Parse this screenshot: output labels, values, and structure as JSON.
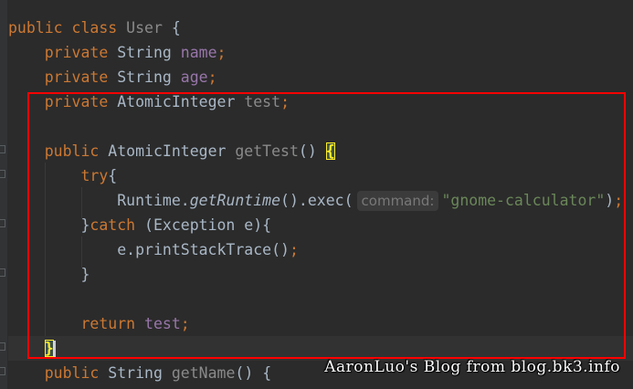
{
  "editor": {
    "lines": {
      "l1": {
        "public": "public",
        "class": "class",
        "name": "User",
        "open": "{"
      },
      "l2": {
        "private": "private",
        "type": "String",
        "field": "name",
        "semi": ";"
      },
      "l3": {
        "private": "private",
        "type": "String",
        "field": "age",
        "semi": ";"
      },
      "l4": {
        "private": "private",
        "type": "AtomicInteger",
        "field": "test",
        "semi": ";"
      },
      "l6": {
        "public": "public",
        "type": "AtomicInteger",
        "method": "getTest",
        "parens": "()",
        "brace": "{"
      },
      "l7": {
        "try": "try",
        "brace": "{"
      },
      "l8": {
        "receiver": "Runtime.",
        "method": "getRuntime",
        "call": "().exec(",
        "hint": "command:",
        "string": "\"gnome-calculator\"",
        "close": ")",
        "semi": ";"
      },
      "l9": {
        "close": "}",
        "catch": "catch",
        "params": " (Exception e){"
      },
      "l10": {
        "call": "e.printStackTrace()",
        "semi": ";"
      },
      "l11": {
        "close": "}"
      },
      "l13": {
        "return": "return",
        "field": "test",
        "semi": ";"
      },
      "l14": {
        "brace": "}"
      },
      "l15": {
        "public": "public",
        "type": "String",
        "method": "getName",
        "parens": "()",
        "brace": "{"
      }
    }
  },
  "watermark": "AaronLuo's Blog from blog.bk3.info",
  "colors": {
    "background": "#2b2b2b",
    "keyword": "#cc7832",
    "field": "#9876aa",
    "string": "#6a8759",
    "highlight_box": "#ff0000",
    "brace_match": "#ffef28"
  }
}
